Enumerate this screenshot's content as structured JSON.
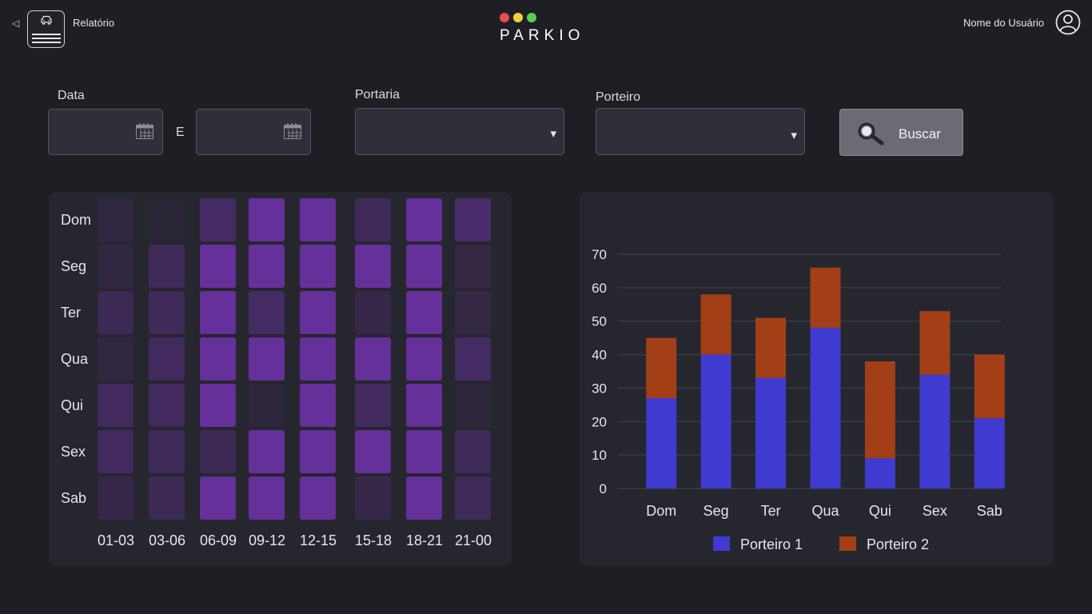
{
  "header": {
    "back_glyph": "◁",
    "menu_icon": "car-menu-icon",
    "report_label": "Relatório",
    "brand": "PARKIO",
    "brand_dot_colors": [
      "#ec4d4d",
      "#f2d03b",
      "#5fce4b"
    ],
    "user_name": "Nome do Usuário",
    "user_icon": "user-circle-icon"
  },
  "filters": {
    "date_label": "Data",
    "date_start_value": "",
    "date_end_value": "",
    "between_label": "E",
    "gate_label": "Portaria",
    "gate_value": "",
    "doorman_label": "Porteiro",
    "doorman_value": "",
    "search_label": "Buscar",
    "dropdown_glyph": "▾"
  },
  "heatmap": {
    "rows": [
      "Dom",
      "Seg",
      "Ter",
      "Qua",
      "Qui",
      "Sex",
      "Sab"
    ],
    "cols": [
      "01-03",
      "03-06",
      "06-09",
      "09-12",
      "12-15",
      "15-18",
      "18-21",
      "21-00"
    ],
    "intensity": [
      [
        0.1,
        0.0,
        0.45,
        1.0,
        1.0,
        0.35,
        1.0,
        0.55
      ],
      [
        0.1,
        0.35,
        1.0,
        1.0,
        1.0,
        1.0,
        1.0,
        0.15
      ],
      [
        0.3,
        0.35,
        1.0,
        0.45,
        1.0,
        0.2,
        1.0,
        0.15
      ],
      [
        0.1,
        0.4,
        1.0,
        1.0,
        1.0,
        1.0,
        1.0,
        0.45
      ],
      [
        0.4,
        0.4,
        1.0,
        0.05,
        1.0,
        0.4,
        1.0,
        0.05
      ],
      [
        0.4,
        0.35,
        0.3,
        1.0,
        1.0,
        1.0,
        1.0,
        0.35
      ],
      [
        0.2,
        0.3,
        1.0,
        1.0,
        1.0,
        0.2,
        1.0,
        0.35
      ]
    ],
    "color_low": "#2b2636",
    "color_high": "#65309a"
  },
  "chart_data": {
    "type": "bar",
    "stacked": true,
    "categories": [
      "Dom",
      "Seg",
      "Ter",
      "Qua",
      "Qui",
      "Sex",
      "Sab"
    ],
    "series": [
      {
        "name": "Porteiro 1",
        "color": "#3f3bd0",
        "values": [
          27,
          40,
          33,
          48,
          9,
          34,
          21
        ]
      },
      {
        "name": "Porteiro 2",
        "color": "#a23f17",
        "values": [
          18,
          18,
          18,
          18,
          29,
          19,
          19
        ]
      }
    ],
    "yticks": [
      0,
      10,
      20,
      30,
      40,
      50,
      60,
      70
    ],
    "ylim": [
      0,
      70
    ],
    "grid": true,
    "legend_position": "bottom"
  }
}
